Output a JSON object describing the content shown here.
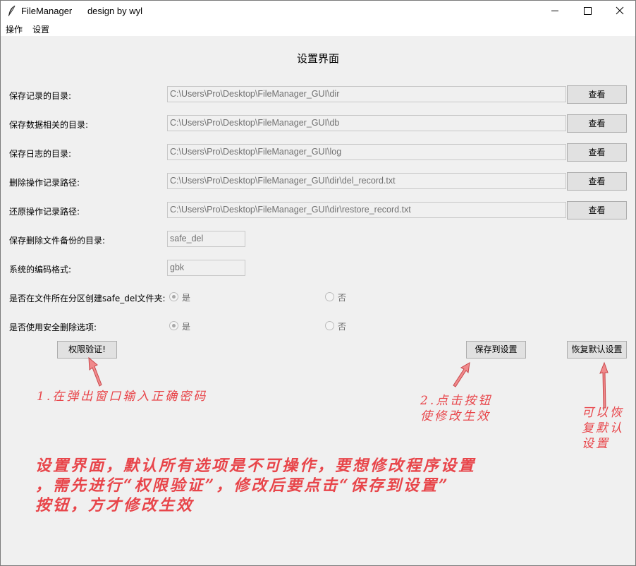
{
  "window": {
    "app_name": "FileManager",
    "subtitle": "design by wyl",
    "icon": "feather-icon"
  },
  "menu": {
    "items": [
      {
        "label": "操作"
      },
      {
        "label": "设置"
      }
    ]
  },
  "page": {
    "heading": "设置界面"
  },
  "settings": {
    "rows": [
      {
        "label": "保存记录的目录:",
        "value": "C:\\Users\\Pro\\Desktop\\FileManager_GUI\\dir",
        "button": "查看"
      },
      {
        "label": "保存数据相关的目录:",
        "value": "C:\\Users\\Pro\\Desktop\\FileManager_GUI\\db",
        "button": "查看"
      },
      {
        "label": "保存日志的目录:",
        "value": "C:\\Users\\Pro\\Desktop\\FileManager_GUI\\log",
        "button": "查看"
      },
      {
        "label": "删除操作记录路径:",
        "value": "C:\\Users\\Pro\\Desktop\\FileManager_GUI\\dir\\del_record.txt",
        "button": "查看"
      },
      {
        "label": "还原操作记录路径:",
        "value": "C:\\Users\\Pro\\Desktop\\FileManager_GUI\\dir\\restore_record.txt",
        "button": "查看"
      }
    ],
    "backup_dir": {
      "label": "保存删除文件备份的目录:",
      "value": "safe_del"
    },
    "encoding": {
      "label": "系统的编码格式:",
      "value": "gbk"
    },
    "create_in_partition": {
      "label": "是否在文件所在分区创建safe_del文件夹:",
      "yes": "是",
      "no": "否",
      "selected": "yes"
    },
    "use_safe_delete": {
      "label": "是否使用安全删除选项:",
      "yes": "是",
      "no": "否",
      "selected": "yes"
    }
  },
  "actions": {
    "auth": "权限验证!",
    "save": "保存到设置",
    "restore_default": "恢复默认设置"
  },
  "annotations": {
    "step1": "1.在弹出窗口输入正确密码",
    "step2": [
      "2.点击按钮",
      "使修改生效"
    ],
    "restore_note": [
      "可以恢",
      "复默认",
      "设置"
    ],
    "summary": [
      "设置界面，默认所有选项是不可操作，要想修改程序设置",
      "，需先进行“权限验证”，修改后要点击“保存到设置”",
      "按钮，方才修改生效"
    ],
    "color": "#e8454a"
  }
}
